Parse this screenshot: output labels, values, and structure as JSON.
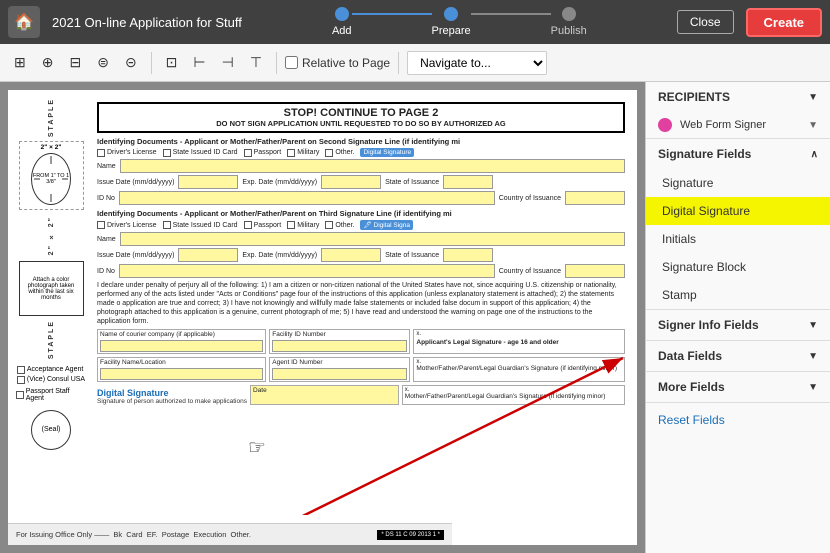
{
  "header": {
    "home_icon": "🏠",
    "title": "2021 On-line Application for Stuff",
    "close_label": "Close",
    "create_label": "Create"
  },
  "progress": {
    "steps": [
      {
        "label": "Add",
        "state": "completed"
      },
      {
        "label": "Prepare",
        "state": "active"
      },
      {
        "label": "Publish",
        "state": "inactive"
      }
    ]
  },
  "toolbar": {
    "navigate_placeholder": "Navigate to...",
    "relative_label": "Relative to Page",
    "buttons": [
      "⊞",
      "⊕",
      "⊟",
      "⊜",
      "⊝",
      "⊞",
      "⊡",
      "⊢",
      "⊣"
    ]
  },
  "doc": {
    "stop_text": "STOP! CONTINUE TO PAGE 2",
    "stop_sub": "DO NOT SIGN APPLICATION UNTIL REQUESTED TO DO SO BY AUTHORIZED AG",
    "section1": "Identifying Documents - Applicant or Mother/Father/Parent on Second Signature Line (if identifying mi",
    "section2": "Identifying Documents - Applicant or Mother/Father/Parent on Third Signature Line (if identifying mi",
    "id_types": [
      "Driver's License",
      "State Issued ID Card",
      "Passport",
      "Military",
      "Other.",
      "Digital Signature"
    ],
    "name_label": "Name",
    "issue_date_label": "Issue Date (mm/dd/yyyy)",
    "exp_date_label": "Exp. Date (mm/dd/yyyy)",
    "state_label": "State of Issuance",
    "id_no_label": "ID No",
    "country_label": "Country of Issuance",
    "para": "I declare under penalty of perjury all of the following: 1) I am a citizen or non-citizen national of the United States have not, since acquiring U.S. citizenship or nationality, performed any of the acts listed under \"Acts or Conditions\" page four of the instructions of this application (unless explanatory statement is attached); 2) the statements made o application are true and correct; 3) I have not knowingly and willfully made false statements or included false docum in support of this application; 4) the photograph attached to this application is a genuine, current photograph of me; 5) I have read and understood the warning on page one of the instructions to the application form.",
    "courier_label": "Name of courier company (if applicable)",
    "facility_label": "Facility ID Number",
    "legal_sig_label": "Applicant's Legal Signature - age 16 and older",
    "facility_name_label": "Facility Name/Location",
    "agent_id_label": "Agent ID Number",
    "mother_sig_label": "Mother/Father/Parent/Legal Guardian's Signature (if identifying minor)",
    "mother_sig_label2": "Mother/Father/Parent/Legal Guardian's Signature (if identifying minor)",
    "digital_sig_label": "Digital Signature",
    "dig_sub": "Signature of person authorized to make applications",
    "acceptance_label": "Acceptance Agent",
    "consular_label": "(Vice) Consul USA",
    "passport_label": "Passport Staff Agent",
    "staple_text": "STAPLE",
    "dimensions": "2\" × 2\"",
    "from_text": "FROM 1\" TO 1 3/8\"",
    "photo_caption": "Attach a color photograph taken within the last six months",
    "seal_text": "(Seal)",
    "footer_items": [
      "For Issuing Office Only ——",
      "Bk",
      "Card",
      "EF.",
      "Postage",
      "Execution",
      "Other.",
      "* DS 11 C 09 2013 1 *"
    ]
  },
  "panel": {
    "recipients_label": "RECIPIENTS",
    "recipient_name": "Web Form Signer",
    "sig_fields_label": "Signature Fields",
    "sig_items": [
      "Signature",
      "Digital Signature",
      "Initials",
      "Signature Block",
      "Stamp"
    ],
    "signer_info_label": "Signer Info Fields",
    "data_fields_label": "Data Fields",
    "more_fields_label": "More Fields",
    "reset_label": "Reset Fields",
    "active_item": "Digital Signature"
  }
}
